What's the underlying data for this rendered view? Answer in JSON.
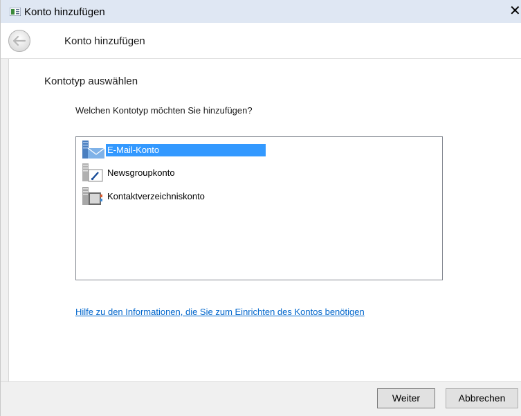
{
  "window": {
    "title": "Konto hinzufügen",
    "close_glyph": "✕",
    "title_bar_color": "#dfe7f3"
  },
  "header": {
    "title": "Konto hinzufügen",
    "back_icon": "back-arrow-icon"
  },
  "content": {
    "section_title": "Kontotyp auswählen",
    "question": "Welchen Kontotyp möchten Sie hinzufügen?",
    "account_types": [
      {
        "label": "E-Mail-Konto",
        "icon": "email-account-icon",
        "selected": true
      },
      {
        "label": "Newsgroupkonto",
        "icon": "newsgroup-account-icon",
        "selected": false
      },
      {
        "label": "Kontaktverzeichniskonto",
        "icon": "directory-account-icon",
        "selected": false
      }
    ],
    "help_link": "Hilfe zu den Informationen, die Sie zum Einrichten des Kontos benötigen",
    "selection_color": "#3399ff",
    "link_color": "#0066cc"
  },
  "footer": {
    "next_label": "Weiter",
    "cancel_label": "Abbrechen"
  }
}
